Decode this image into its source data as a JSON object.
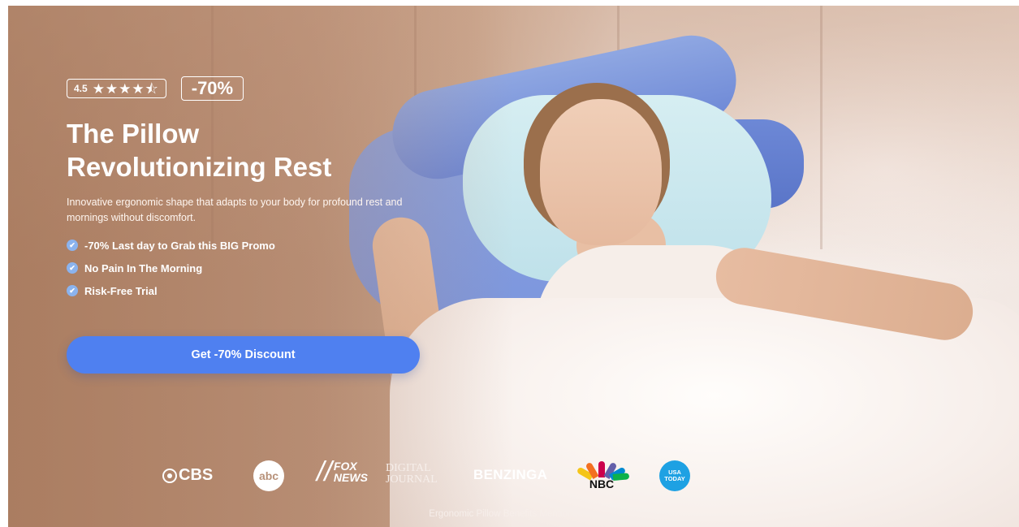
{
  "hero": {
    "rating_value": "4.5",
    "stars": "★★★★⯪",
    "discount_badge": "-70%",
    "title_line1": "The Pillow",
    "title_line2": "Revolutionizing Rest",
    "subtitle": "Innovative ergonomic shape that adapts to your body for profound rest and mornings without discomfort.",
    "benefits": [
      "-70% Last day to Grab this BIG Promo",
      "No Pain In The Morning",
      "Risk-Free Trial"
    ],
    "cta_label": "Get -70% Discount"
  },
  "press": {
    "logos": {
      "cbs": "CBS",
      "abc": "abc",
      "fox_line1": "FOX",
      "fox_line2": "NEWS",
      "dj_line1": "DIGITAL",
      "dj_line2": "JOURNAL",
      "benzinga": "BENZINGA",
      "nbc": "NBC",
      "usa_line1": "USA",
      "usa_line2": "TODAY"
    },
    "caption": "Ergonomic Pillow Benefits Mentioned On"
  },
  "colors": {
    "cta": "#4f80f0",
    "check": "#8bb3ee",
    "usa_today": "#1ea1e3"
  },
  "icons": [
    "star-icon",
    "half-star-icon",
    "check-circle-icon",
    "cbs-eye-icon",
    "nbc-peacock-icon"
  ]
}
